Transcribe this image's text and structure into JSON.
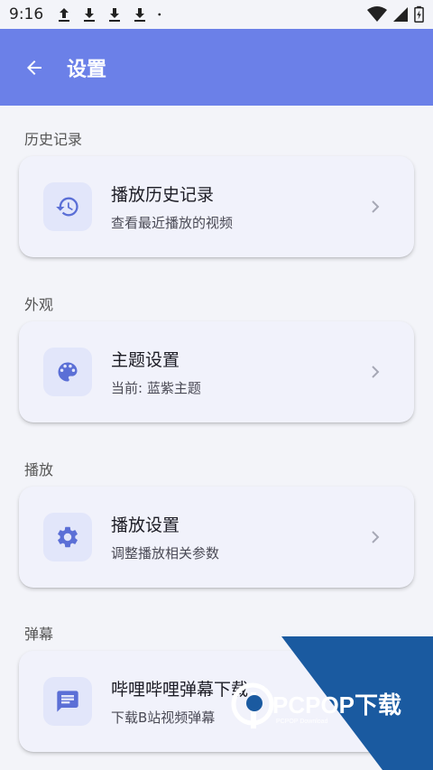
{
  "status": {
    "time": "9:16"
  },
  "header": {
    "title": "设置",
    "back_icon": "arrow-back-icon"
  },
  "sections": [
    {
      "label": "历史记录",
      "card": {
        "title": "播放历史记录",
        "subtitle": "查看最近播放的视频",
        "icon": "history-icon"
      }
    },
    {
      "label": "外观",
      "card": {
        "title": "主题设置",
        "subtitle": "当前: 蓝紫主题",
        "icon": "palette-icon"
      }
    },
    {
      "label": "播放",
      "card": {
        "title": "播放设置",
        "subtitle": "调整播放相关参数",
        "icon": "gear-icon"
      }
    },
    {
      "label": "弹幕",
      "card": {
        "title": "哔哩哔哩弹幕下载",
        "subtitle": "下载B站视频弹幕",
        "icon": "comment-icon"
      }
    }
  ],
  "watermark": {
    "brand": "PCPOP下载",
    "tagline": "PCPOP Download"
  },
  "colors": {
    "app_bar": "#6b80e8",
    "icon_accent": "#5b6fd6",
    "background": "#f3f4f9"
  }
}
